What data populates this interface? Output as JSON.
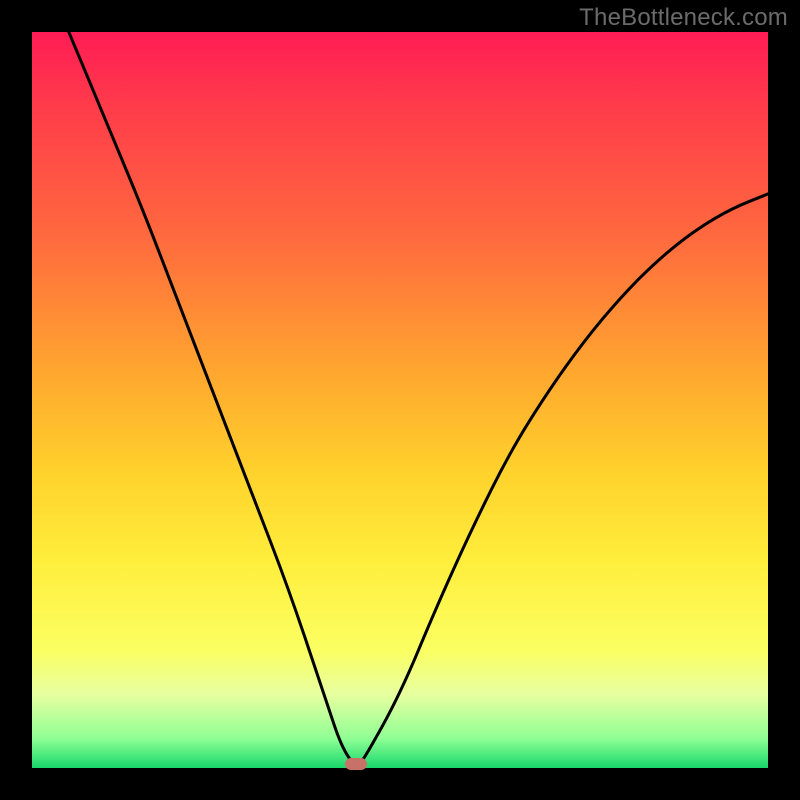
{
  "watermark": "TheBottleneck.com",
  "chart_data": {
    "type": "line",
    "title": "",
    "xlabel": "",
    "ylabel": "",
    "xlim": [
      0,
      100
    ],
    "ylim": [
      0,
      100
    ],
    "grid": false,
    "legend": false,
    "x": [
      5,
      10,
      15,
      20,
      25,
      30,
      35,
      40,
      42,
      44,
      45,
      50,
      55,
      60,
      65,
      70,
      75,
      80,
      85,
      90,
      95,
      100
    ],
    "values": [
      100,
      88,
      76,
      63,
      50,
      37,
      24,
      9,
      3,
      0,
      1,
      10,
      22,
      33,
      43,
      51,
      58,
      64,
      69,
      73,
      76,
      78
    ],
    "minimum": {
      "x": 44,
      "y": 0
    },
    "marker": {
      "x": 44,
      "y": 0,
      "color": "#c77168",
      "shape": "pill"
    }
  },
  "colors": {
    "frame": "#000000",
    "curve": "#000000",
    "watermark": "#6b6b6b",
    "marker": "#c77168"
  }
}
